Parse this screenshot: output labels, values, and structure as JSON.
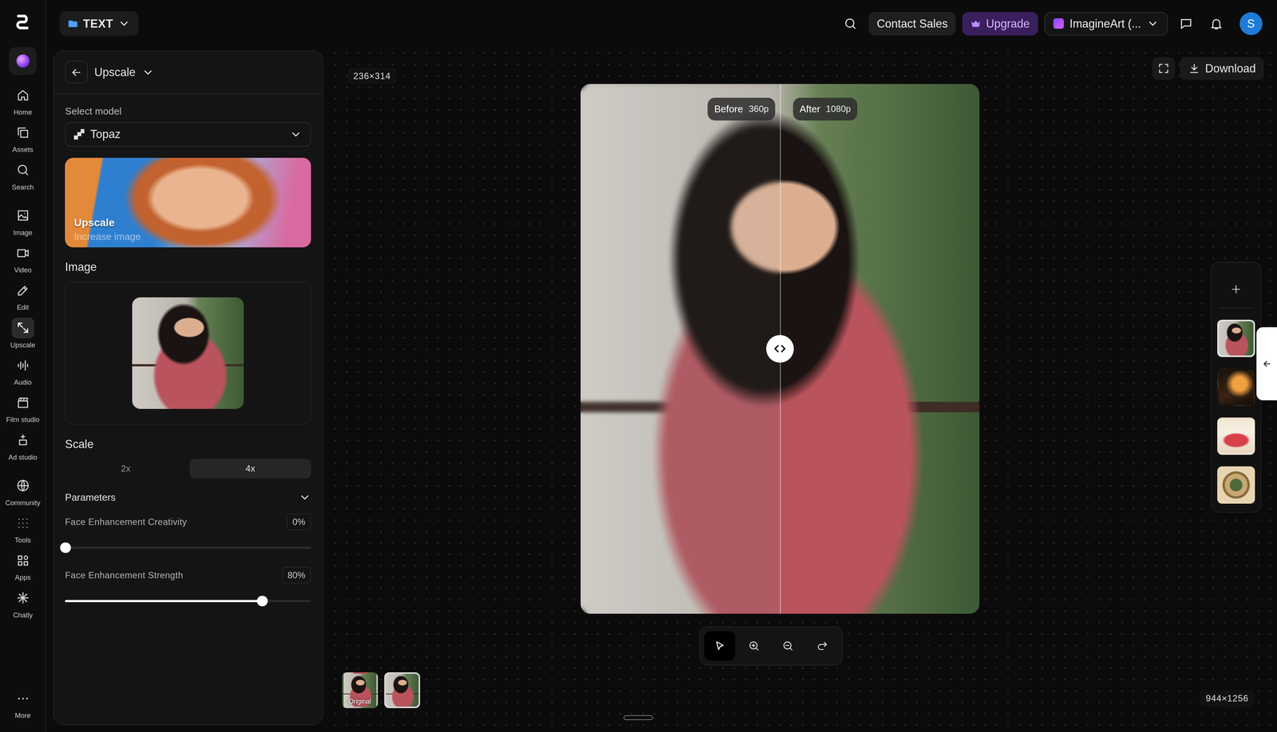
{
  "nav": {
    "groups": [
      [
        {
          "label": "Home",
          "selected": false
        },
        {
          "label": "Assets",
          "selected": false
        },
        {
          "label": "Search",
          "selected": false
        }
      ],
      [
        {
          "label": "Image",
          "selected": false
        },
        {
          "label": "Video",
          "selected": false
        },
        {
          "label": "Edit",
          "selected": false
        },
        {
          "label": "Upscale",
          "selected": true
        },
        {
          "label": "Audio",
          "selected": false
        },
        {
          "label": "Film studio",
          "selected": false
        },
        {
          "label": "Ad studio",
          "selected": false
        }
      ],
      [
        {
          "label": "Community",
          "selected": false
        },
        {
          "label": "Tools",
          "selected": false
        },
        {
          "label": "Apps",
          "selected": false
        },
        {
          "label": "Chatly",
          "selected": false
        }
      ]
    ],
    "more": "More"
  },
  "topbar": {
    "project": "TEXT",
    "contact": "Contact Sales",
    "upgrade": "Upgrade",
    "workspace": "ImagineArt (...",
    "avatar": "S"
  },
  "panel": {
    "title": "Upscale",
    "model_label": "Select model",
    "model": "Topaz",
    "banner": {
      "title": "Upscale",
      "subtitle": "Increase image"
    },
    "image_label": "Image",
    "scale_label": "Scale",
    "scales": [
      {
        "label": "2x",
        "selected": false
      },
      {
        "label": "4x",
        "selected": true
      }
    ],
    "parameters": {
      "label": "Parameters",
      "expanded": true
    },
    "sliders": [
      {
        "label": "Face Enhancement Creativity",
        "value": "0%",
        "level": 0
      },
      {
        "label": "Face Enhancement Strength",
        "value": "80%",
        "level": 0.8
      }
    ]
  },
  "canvas": {
    "input_size": "236×314",
    "output_size": "944×1256",
    "download": "Download",
    "split": 0.5,
    "before": {
      "label": "Before",
      "res": "360p"
    },
    "after": {
      "label": "After",
      "res": "1080p"
    },
    "tools": [
      {
        "selected": true
      },
      {
        "selected": false
      },
      {
        "selected": false
      },
      {
        "selected": false
      }
    ],
    "versions": [
      {
        "label": "Original",
        "selected": false
      },
      {
        "label": "",
        "selected": true
      }
    ]
  },
  "history": {
    "items": [
      {
        "selected": true
      },
      {
        "selected": false
      },
      {
        "selected": false
      },
      {
        "selected": false
      }
    ]
  }
}
